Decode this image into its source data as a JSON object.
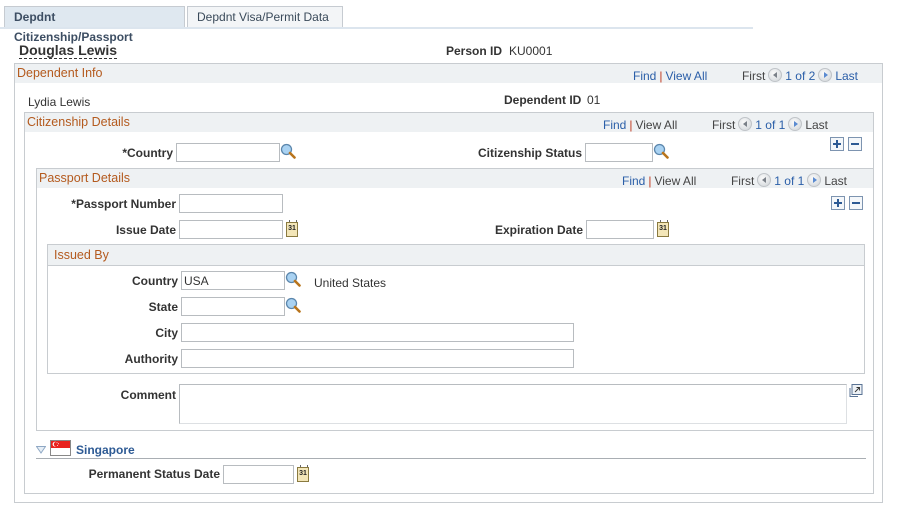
{
  "tabs": [
    {
      "label": "Depdnt Citizenship/Passport",
      "active": true
    },
    {
      "label": "Depdnt Visa/Permit Data",
      "active": false
    }
  ],
  "header": {
    "person_name": "Douglas Lewis",
    "person_id_label": "Person ID",
    "person_id_value": "KU0001"
  },
  "dependent_info": {
    "title": "Dependent Info",
    "find": "Find",
    "separator": "|",
    "view_all": "View All",
    "first": "First",
    "count": "1 of 2",
    "last": "Last",
    "dependent_name": "Lydia Lewis",
    "dependent_id_label": "Dependent ID",
    "dependent_id_value": "01"
  },
  "citizenship_details": {
    "title": "Citizenship Details",
    "find": "Find",
    "separator": "|",
    "view_all": "View All",
    "first": "First",
    "count": "1 of 1",
    "last": "Last",
    "country_label": "*Country",
    "country_value": "",
    "status_label": "Citizenship Status",
    "status_value": ""
  },
  "passport_details": {
    "title": "Passport Details",
    "find": "Find",
    "separator": "|",
    "view_all": "View All",
    "first": "First",
    "count": "1 of 1",
    "last": "Last",
    "passport_number_label": "*Passport Number",
    "passport_number_value": "",
    "issue_date_label": "Issue Date",
    "issue_date_value": "",
    "expiration_date_label": "Expiration Date",
    "expiration_date_value": "",
    "calendar_glyph": "31",
    "comment_label": "Comment",
    "comment_value": ""
  },
  "issued_by": {
    "title": "Issued By",
    "country_label": "Country",
    "country_value": "USA",
    "country_description": "United States",
    "state_label": "State",
    "state_value": "",
    "city_label": "City",
    "city_value": "",
    "authority_label": "Authority",
    "authority_value": ""
  },
  "singapore": {
    "title": "Singapore",
    "permanent_status_date_label": "Permanent Status Date",
    "permanent_status_date_value": ""
  }
}
